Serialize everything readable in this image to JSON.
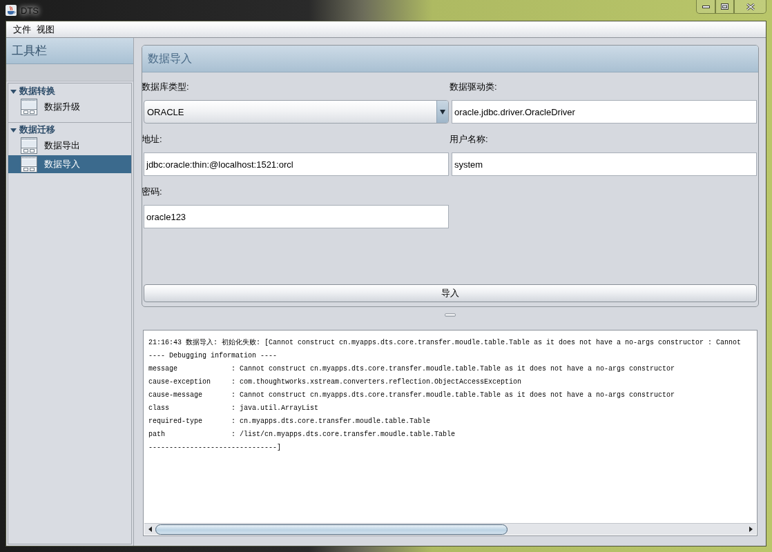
{
  "window": {
    "title": "DTS"
  },
  "menu": [
    {
      "label": "文件"
    },
    {
      "label": "视图"
    }
  ],
  "sidebar": {
    "title": "工具栏",
    "groups": [
      {
        "label": "数据转换",
        "expanded": true,
        "items": [
          {
            "label": "数据升级",
            "selected": false
          }
        ]
      },
      {
        "label": "数据迁移",
        "expanded": true,
        "items": [
          {
            "label": "数据导出",
            "selected": false
          },
          {
            "label": "数据导入",
            "selected": true
          }
        ]
      }
    ]
  },
  "import_panel": {
    "title": "数据导入",
    "fields": [
      {
        "kind": "select",
        "label": "数据库类型:",
        "value": "ORACLE"
      },
      {
        "kind": "text",
        "label": "数据驱动类:",
        "value": "oracle.jdbc.driver.OracleDriver"
      },
      {
        "kind": "text",
        "label": "地址:",
        "value": "jdbc:oracle:thin:@localhost:1521:orcl"
      },
      {
        "kind": "text",
        "label": "用户名称:",
        "value": "system"
      },
      {
        "kind": "text",
        "label": "密码:",
        "value": "oracle123"
      }
    ],
    "button": "导入"
  },
  "log": {
    "lines": [
      "21:16:43 数据导入: 初始化失败: [Cannot construct cn.myapps.dts.core.transfer.moudle.table.Table as it does not have a no-args constructor : Cannot",
      "---- Debugging information ----",
      "message             : Cannot construct cn.myapps.dts.core.transfer.moudle.table.Table as it does not have a no-args constructor",
      "cause-exception     : com.thoughtworks.xstream.converters.reflection.ObjectAccessException",
      "cause-message       : Cannot construct cn.myapps.dts.core.transfer.moudle.table.Table as it does not have a no-args constructor",
      "class               : java.util.ArrayList",
      "required-type       : cn.myapps.dts.core.transfer.moudle.table.Table",
      "path                : /list/cn.myapps.dts.core.transfer.moudle.table.Table",
      "-------------------------------]"
    ]
  }
}
